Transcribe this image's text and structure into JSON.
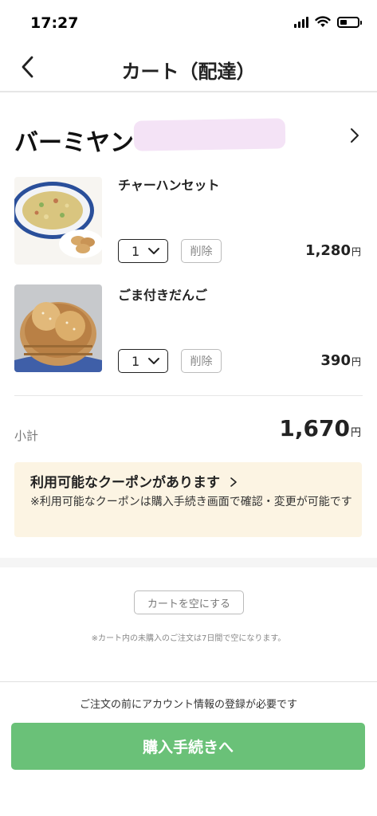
{
  "status_bar": {
    "time": "17:27"
  },
  "nav": {
    "title": "カート（配達）"
  },
  "shop": {
    "name": "バーミヤン"
  },
  "items": [
    {
      "name": "チャーハンセット",
      "quantity": "1",
      "delete_label": "削除",
      "price": "1,280",
      "currency": "円"
    },
    {
      "name": "ごま付きだんご",
      "quantity": "1",
      "delete_label": "削除",
      "price": "390",
      "currency": "円"
    }
  ],
  "subtotal": {
    "label": "小計",
    "value": "1,670",
    "currency": "円"
  },
  "coupon": {
    "title": "利用可能なクーポンがあります",
    "note": "※利用可能なクーポンは購入手続き画面で確認・変更が可能です"
  },
  "empty_cart": {
    "button_label": "カートを空にする",
    "note": "※カート内の未購入のご注文は7日間で空になります。"
  },
  "checkout": {
    "account_note": "ご注文の前にアカウント情報の登録が必要です",
    "button_label": "購入手続きへ"
  },
  "colors": {
    "checkout_button": "#6ac178",
    "coupon_background": "#fcf4e3"
  }
}
